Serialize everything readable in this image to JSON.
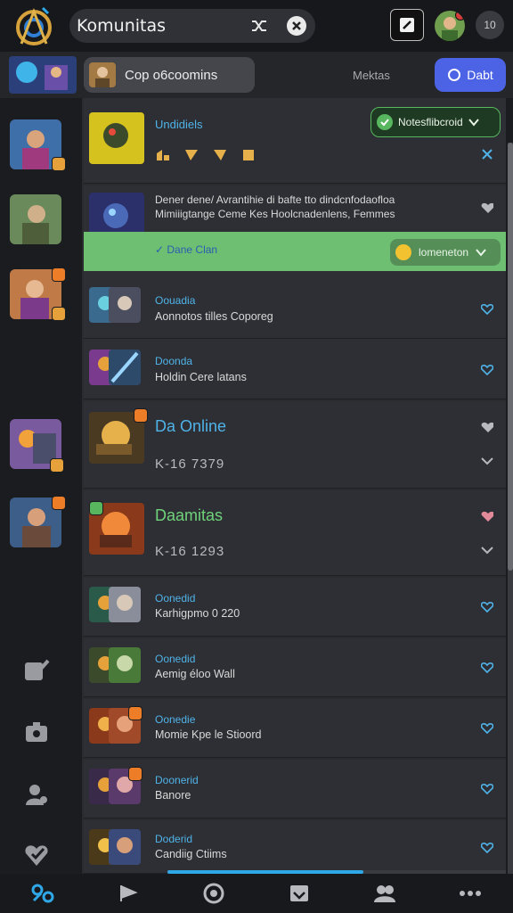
{
  "header": {
    "title": "Komunitas",
    "notification_count": "10",
    "icons": [
      "app-logo",
      "shuffle-icon",
      "close-icon",
      "compose-icon",
      "avatar"
    ]
  },
  "subbar": {
    "group_label": "Cop o6coomins",
    "status_label": "Mektas",
    "action_label": "Dabt"
  },
  "rows": [
    {
      "name": "Undidiels",
      "sub": "",
      "check_label": "Notesflibcroid"
    },
    {
      "name": "",
      "sub": "Dener dene/ Avrantihie di bafte tto dindcnfodaofloa Mimiiigtange Ceme Kes Hoolcnadenlens, Femmes",
      "band_text": "✓ Dane Clan",
      "band_pill": "lomeneton"
    },
    {
      "name": "Oouadia",
      "sub": "Aonnotos tilles Coporeg"
    },
    {
      "name": "Doonda",
      "sub": "Holdin Cere latans"
    },
    {
      "name": "Da Online",
      "sub": "K-16 7379"
    },
    {
      "name": "Daamitas",
      "sub": "K-16 1293"
    },
    {
      "name": "Oonedid",
      "sub": "Karhigpmo 0 220"
    },
    {
      "name": "Oonedid",
      "sub": "Aemig éloo Wall"
    },
    {
      "name": "Oonedie",
      "sub": "Momie Kpe le Stioord"
    },
    {
      "name": "Doonerid",
      "sub": "Banore"
    },
    {
      "name": "Doderid",
      "sub": "Candiig Ctiims"
    }
  ],
  "colors": {
    "accent_blue": "#4c63e6",
    "link_blue": "#4fb3e8",
    "online_green": "#57b65e",
    "badge_orange": "#ee7d28"
  },
  "bottom_nav": [
    "community-icon",
    "flag-icon",
    "circle-icon",
    "inbox-icon",
    "people-icon",
    "more-icon"
  ],
  "scroll_progress": 0.58
}
